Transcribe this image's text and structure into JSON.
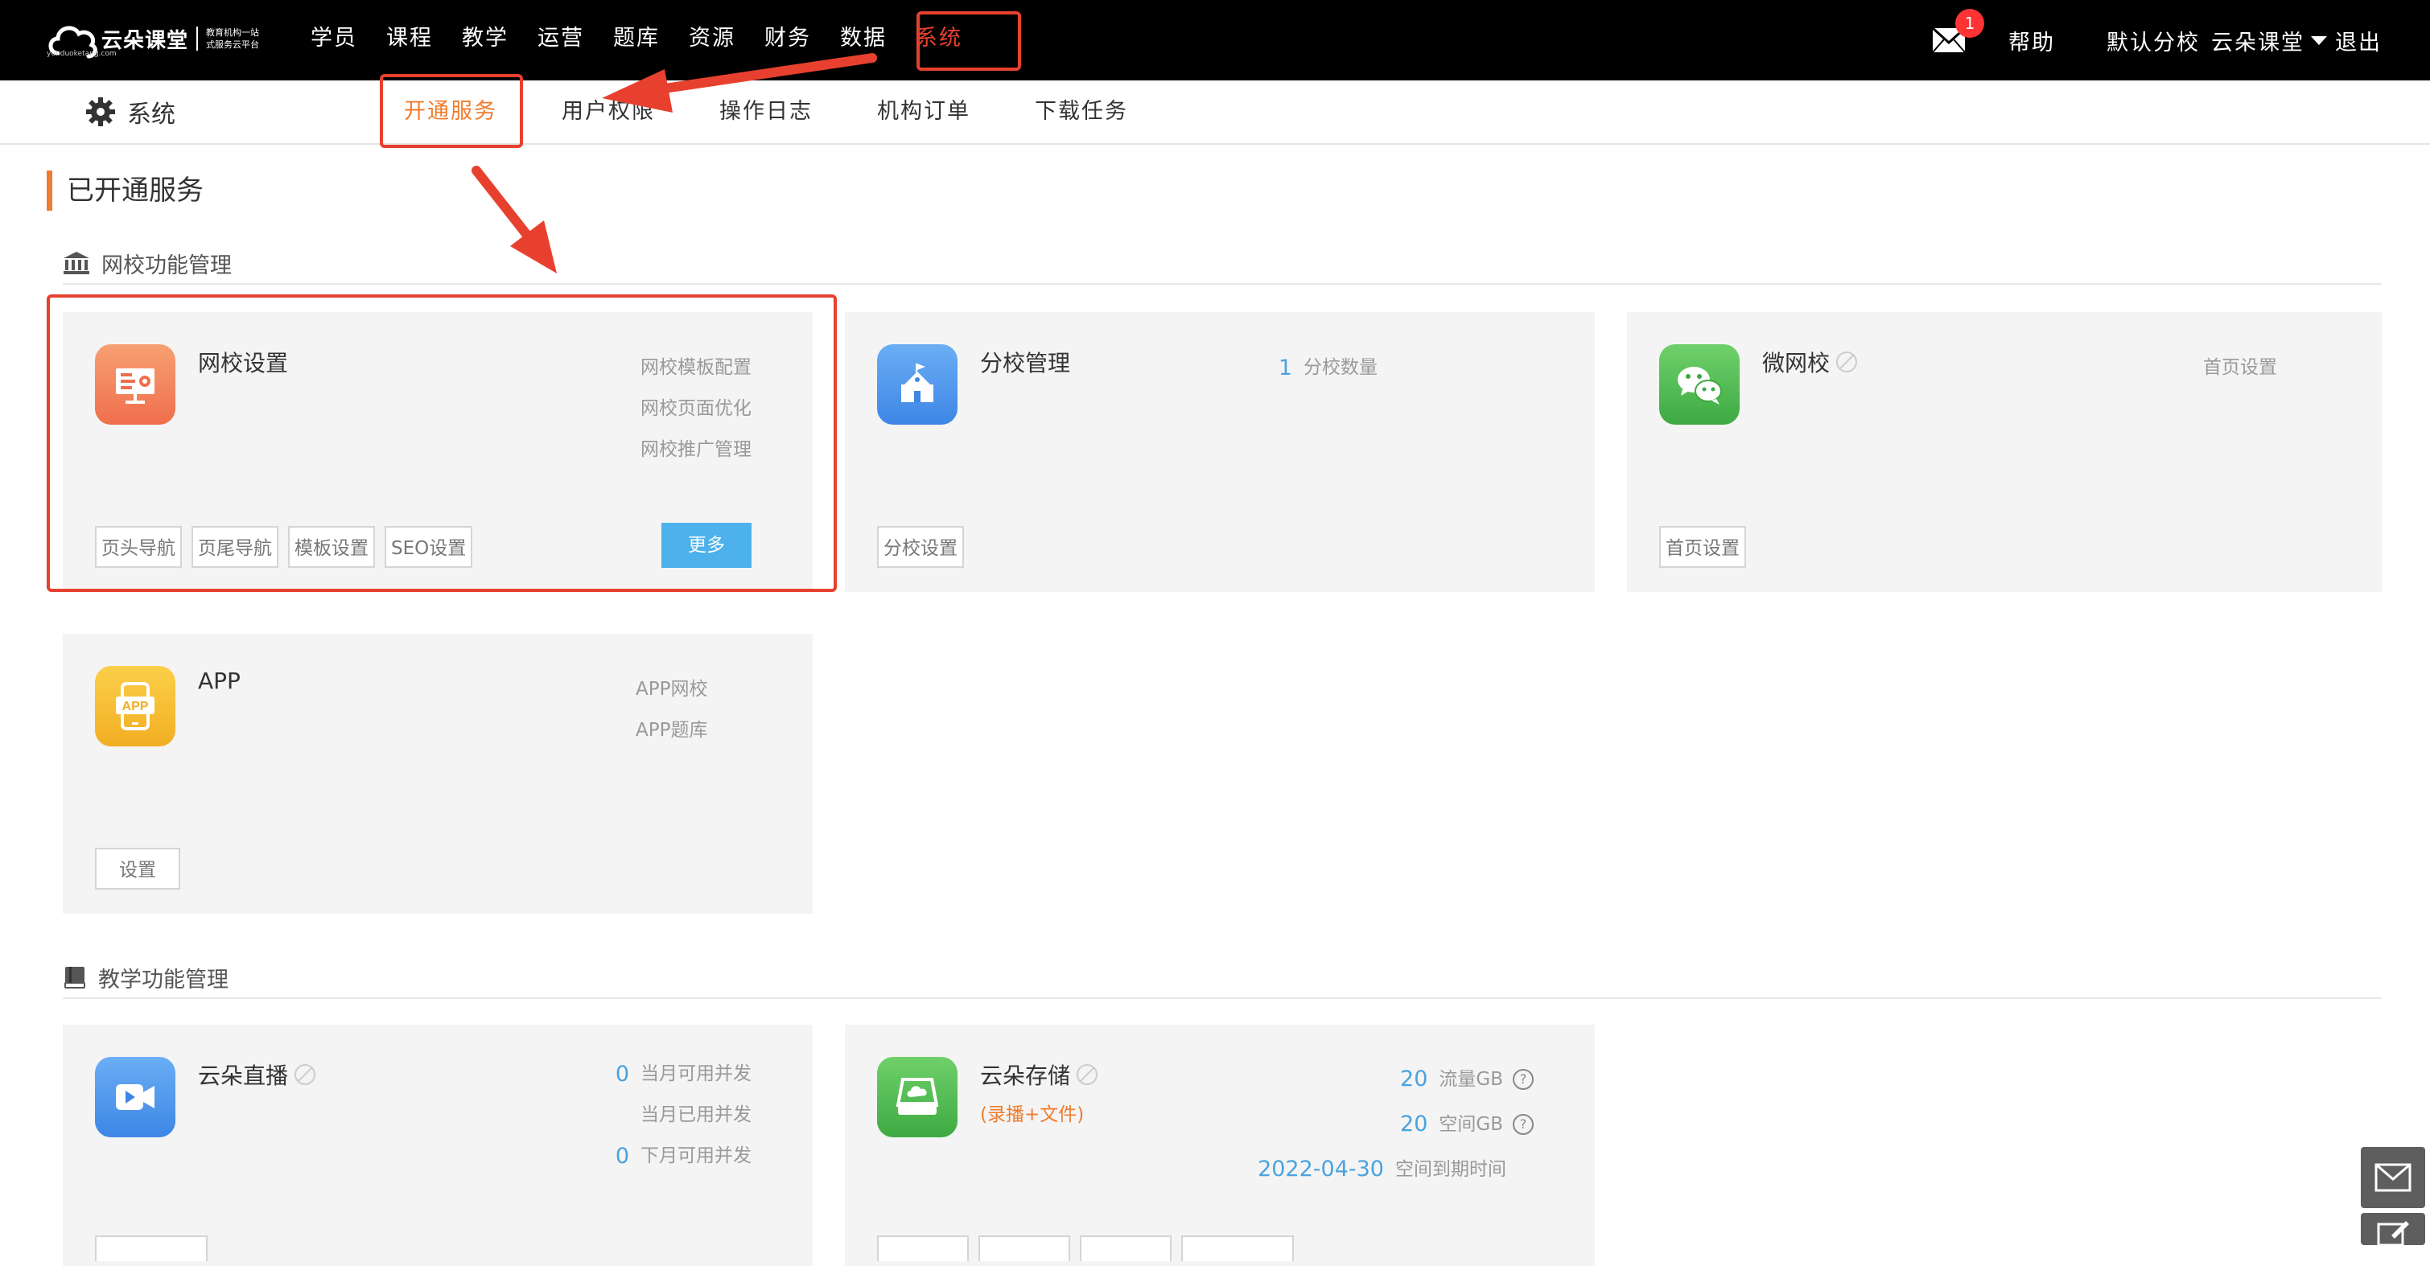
{
  "brand": {
    "name": "云朵课堂",
    "tagline_1": "教育机构一站",
    "tagline_2": "式服务云平台",
    "url": "yunduoketang.com"
  },
  "main_nav": [
    "学员",
    "课程",
    "教学",
    "运营",
    "题库",
    "资源",
    "财务",
    "数据",
    "系统"
  ],
  "main_nav_active": "系统",
  "topright": {
    "mail_badge": "1",
    "help": "帮助",
    "school": "默认分校",
    "user": "云朵课堂",
    "logout": "退出"
  },
  "subbar": {
    "title": "系统",
    "tabs": [
      "开通服务",
      "用户权限",
      "操作日志",
      "机构订单",
      "下载任务"
    ],
    "active_tab": "开通服务"
  },
  "page": {
    "section_title": "已开通服务",
    "groups": {
      "school": "网校功能管理",
      "teaching": "教学功能管理"
    }
  },
  "cards": {
    "wangxiao": {
      "name": "网校设置",
      "links": [
        "网校模板配置",
        "网校页面优化",
        "网校推广管理"
      ],
      "buttons": [
        "页头导航",
        "页尾导航",
        "模板设置",
        "SEO设置"
      ],
      "more": "更多"
    },
    "fenxiao": {
      "name": "分校管理",
      "stat_value": "1",
      "stat_label": "分校数量",
      "buttons": [
        "分校设置"
      ]
    },
    "weiwangxiao": {
      "name": "微网校",
      "link": "首页设置",
      "buttons": [
        "首页设置"
      ]
    },
    "app": {
      "name": "APP",
      "links": [
        "APP网校",
        "APP题库"
      ],
      "buttons": [
        "设置"
      ]
    },
    "zhibo": {
      "name": "云朵直播",
      "stats": [
        {
          "value": "0",
          "label": "当月可用并发"
        },
        {
          "value": "",
          "label": "当月已用并发"
        },
        {
          "value": "0",
          "label": "下月可用并发"
        }
      ]
    },
    "cunchu": {
      "name": "云朵存储",
      "note": "(录播+文件)",
      "stats": [
        {
          "value": "20",
          "label": "流量GB"
        },
        {
          "value": "20",
          "label": "空间GB"
        },
        {
          "value": "2022-04-30",
          "label": "空间到期时间"
        }
      ]
    }
  },
  "colors": {
    "accent_orange": "#f07c2d",
    "highlight_red": "#e8402f",
    "button_blue": "#4db1ec",
    "stat_blue": "#4aa3df"
  }
}
